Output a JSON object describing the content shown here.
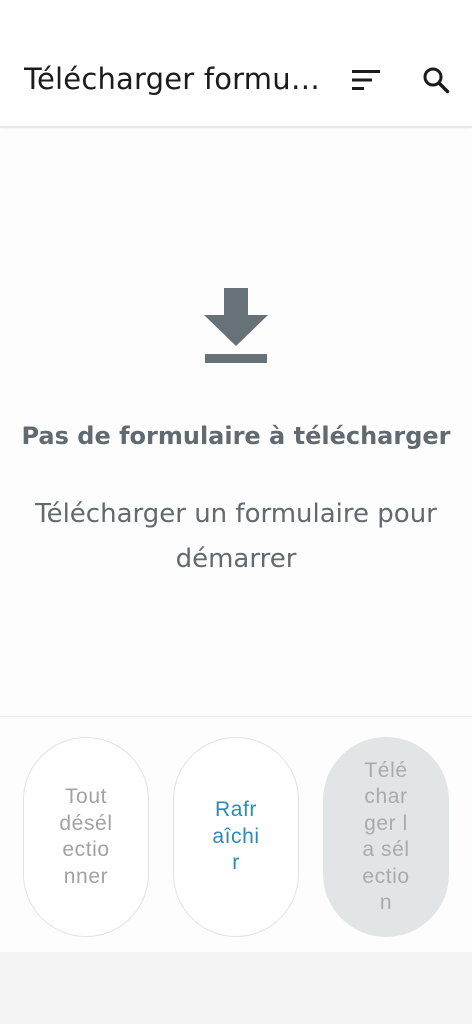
{
  "app_bar": {
    "title": "Télécharger formulaire",
    "sort_icon": "sort-icon",
    "search_icon": "search-icon"
  },
  "empty_state": {
    "icon": "download-icon",
    "title": "Pas de formulaire à télécharger",
    "subtitle": "Télécharger un formulaire pour démarrer"
  },
  "actions": {
    "deselect_all": "Tout désélectionner",
    "refresh": "Rafraîchir",
    "download_selected": "Télécharger la sélection"
  },
  "colors": {
    "primary_text": "#1b1b1b",
    "muted_text": "#606a70",
    "accent": "#2c8ab8",
    "disabled_fill": "#e2e5e6"
  }
}
